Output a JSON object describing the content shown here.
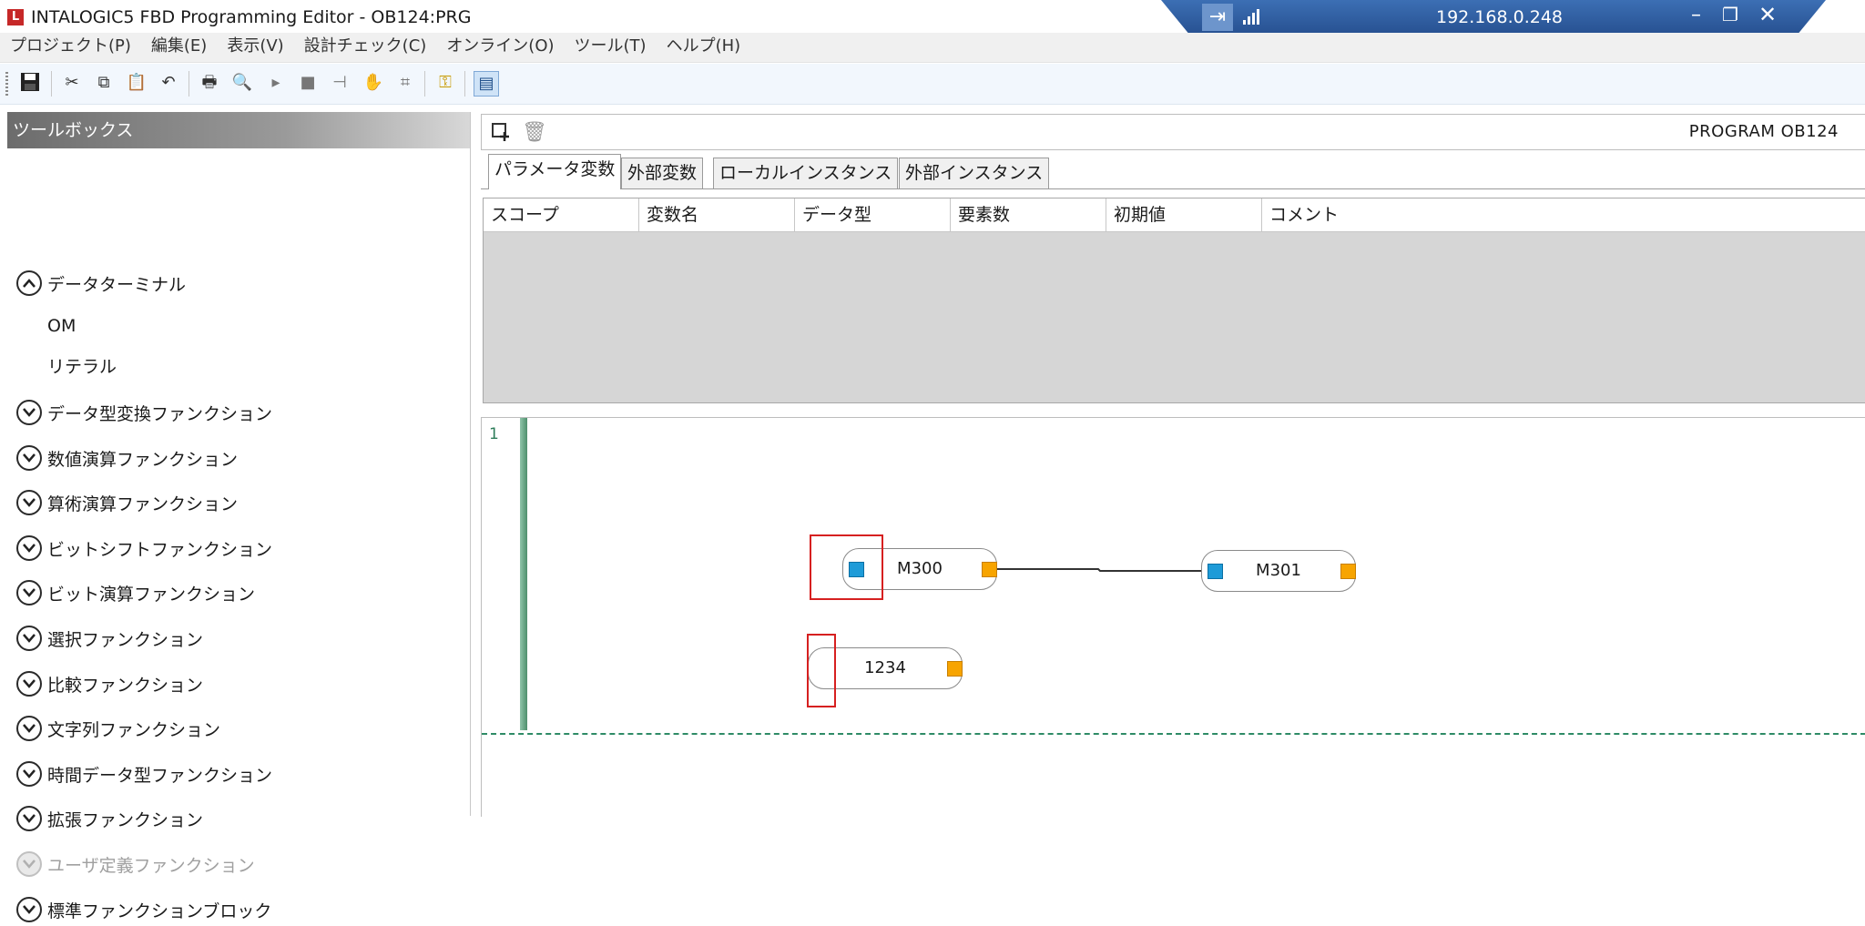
{
  "window": {
    "title": "INTALOGIC5 FBD Programming Editor - OB124:PRG",
    "logo": "L"
  },
  "remote": {
    "ip": "192.168.0.248",
    "pin_icon": "pin-icon",
    "signal_icon": "signal-bars-icon"
  },
  "menu": [
    "プロジェクト(P)",
    "編集(E)",
    "表示(V)",
    "設計チェック(C)",
    "オンライン(O)",
    "ツール(T)",
    "ヘルプ(H)"
  ],
  "toolbar": {
    "icons": [
      "save-icon",
      "cut-icon",
      "copy-icon",
      "paste-icon",
      "undo-icon",
      "print-icon",
      "print-preview-icon",
      "run-icon",
      "stop-icon",
      "step-icon",
      "hand-icon",
      "monitor-icon",
      "key-icon",
      "document-list-icon"
    ]
  },
  "toolbox": {
    "title": "ツールボックス",
    "expanded": {
      "label": "データターミナル",
      "items": [
        "OM",
        "リテラル"
      ]
    },
    "categories": [
      "データ型変換ファンクション",
      "数値演算ファンクション",
      "算術演算ファンクション",
      "ビットシフトファンクション",
      "ビット演算ファンクション",
      "選択ファンクション",
      "比較ファンクション",
      "文字列ファンクション",
      "時間データ型ファンクション",
      "拡張ファンクション",
      "ユーザ定義ファンクション",
      "標準ファンクションブロック"
    ],
    "disabled_category": "ユーザ定義ファンクション"
  },
  "program": {
    "name": "PROGRAM OB124"
  },
  "tabs": [
    "パラメータ変数",
    "外部変数",
    "ローカルインスタンス",
    "外部インスタンス"
  ],
  "active_tab": "パラメータ変数",
  "var_table": {
    "columns": [
      "スコープ",
      "変数名",
      "データ型",
      "要素数",
      "初期値",
      "コメント"
    ]
  },
  "diagram": {
    "line_number": "1",
    "blocks": [
      {
        "label": "M300"
      },
      {
        "label": "M301"
      },
      {
        "label": "1234"
      }
    ]
  },
  "colors": {
    "input_pin": "#1e9bd8",
    "output_pin": "#f7a400",
    "highlight": "#d62020",
    "remote_bar": "#2f5fa3",
    "rung_rail": "#4e8f6c"
  }
}
